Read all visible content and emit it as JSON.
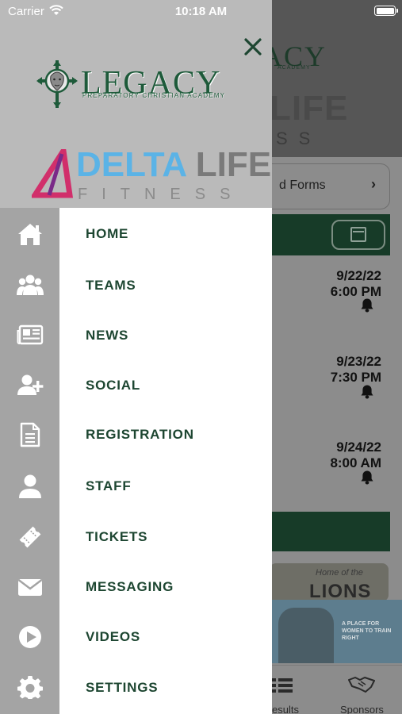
{
  "status_bar": {
    "carrier": "Carrier",
    "time": "10:18 AM",
    "battery_level": 1.0
  },
  "drawer": {
    "legacy_logo": {
      "title": "LEGACY",
      "subtitle": "PREPARATORY CHRISTIAN ACADEMY"
    },
    "sponsor_logo": {
      "word1": "DELTA",
      "word2": "LIFE",
      "tagline": "FITNESS"
    },
    "menu": [
      {
        "label": "HOME",
        "icon": "home-icon"
      },
      {
        "label": "TEAMS",
        "icon": "teams-icon"
      },
      {
        "label": "NEWS",
        "icon": "news-icon"
      },
      {
        "label": "SOCIAL",
        "icon": "social-icon"
      },
      {
        "label": "REGISTRATION",
        "icon": "registration-icon"
      },
      {
        "label": "STAFF",
        "icon": "staff-icon"
      },
      {
        "label": "TICKETS",
        "icon": "tickets-icon"
      },
      {
        "label": "MESSAGING",
        "icon": "messaging-icon"
      },
      {
        "label": "VIDEOS",
        "icon": "videos-icon"
      },
      {
        "label": "SETTINGS",
        "icon": "settings-icon"
      }
    ]
  },
  "background": {
    "logo_partial": "ACY",
    "logo_sub_partial": "ACADEMY",
    "sponsor_partial": "LIFE",
    "sponsor_tagline_partial": "SS",
    "forms_label": "d Forms",
    "events": [
      {
        "date": "9/22/22",
        "time": "6:00 PM"
      },
      {
        "date": "9/23/22",
        "time": "7:30 PM"
      },
      {
        "date": "9/24/22",
        "time": "8:00 AM"
      }
    ],
    "promo_title": "LIONS",
    "promo_script": "Home of the",
    "banner_text": "A PLACE FOR WOMEN TO TRAIN RIGHT",
    "tabs": [
      {
        "label": "esults",
        "icon": "list-icon"
      },
      {
        "label": "Sponsors",
        "icon": "handshake-icon"
      }
    ]
  },
  "colors": {
    "brand_green": "#1d4631",
    "delta_blue": "#5bb3e6",
    "drawer_header_bg": "#bababa",
    "icon_rail_bg": "#a4a4a4"
  }
}
